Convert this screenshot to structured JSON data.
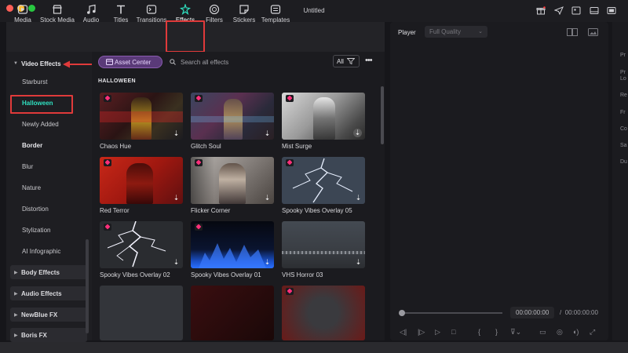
{
  "window": {
    "title": "Untitled",
    "traffic_colors": [
      "#fe5f57",
      "#febc2e",
      "#28c840"
    ]
  },
  "toolbar": {
    "items": [
      {
        "label": "Media",
        "icon": "media-icon"
      },
      {
        "label": "Stock Media",
        "icon": "stock-media-icon"
      },
      {
        "label": "Audio",
        "icon": "music-note-icon"
      },
      {
        "label": "Titles",
        "icon": "titles-t-icon"
      },
      {
        "label": "Transitions",
        "icon": "transitions-icon"
      },
      {
        "label": "Effects",
        "icon": "effects-sparkle-icon"
      },
      {
        "label": "Filters",
        "icon": "filters-icon"
      },
      {
        "label": "Stickers",
        "icon": "stickers-icon"
      },
      {
        "label": "Templates",
        "icon": "templates-icon"
      }
    ],
    "active": "Effects",
    "accent": "#2fe0c0"
  },
  "sidebar": {
    "header": "Video Effects",
    "subcategories": [
      "Starburst",
      "Halloween",
      "Newly Added",
      "Border",
      "Blur",
      "Nature",
      "Distortion",
      "Stylization",
      "AI Infographic"
    ],
    "selected": "Halloween",
    "groups": [
      "Body Effects",
      "Audio Effects",
      "NewBlue FX",
      "Boris FX"
    ]
  },
  "library": {
    "asset_center_label": "Asset Center",
    "search_placeholder": "Search all effects",
    "filter_label": "All",
    "section_title": "HALLOWEEN",
    "effects": [
      {
        "name": "Chaos Hue",
        "premium": true
      },
      {
        "name": "Glitch Soul",
        "premium": true
      },
      {
        "name": "Mist Surge",
        "premium": true
      },
      {
        "name": "Red Terror",
        "premium": true
      },
      {
        "name": "Flicker Corner",
        "premium": true
      },
      {
        "name": "Spooky Vibes Overlay 05",
        "premium": true
      },
      {
        "name": "Spooky Vibes Overlay 02",
        "premium": true
      },
      {
        "name": "Spooky Vibes Overlay 01",
        "premium": true
      },
      {
        "name": "VHS Horror 03",
        "premium": false
      }
    ]
  },
  "player": {
    "label": "Player",
    "quality": "Full Quality",
    "current_time": "00:00:00:00",
    "total_time": "00:00:00:00",
    "separator": "/"
  },
  "properties": {
    "labels": [
      "Pr",
      "Pr",
      "Lo",
      "Re",
      "Fr",
      "Co",
      "Sa",
      "Du"
    ]
  },
  "annotation_color": "#e03a3a"
}
